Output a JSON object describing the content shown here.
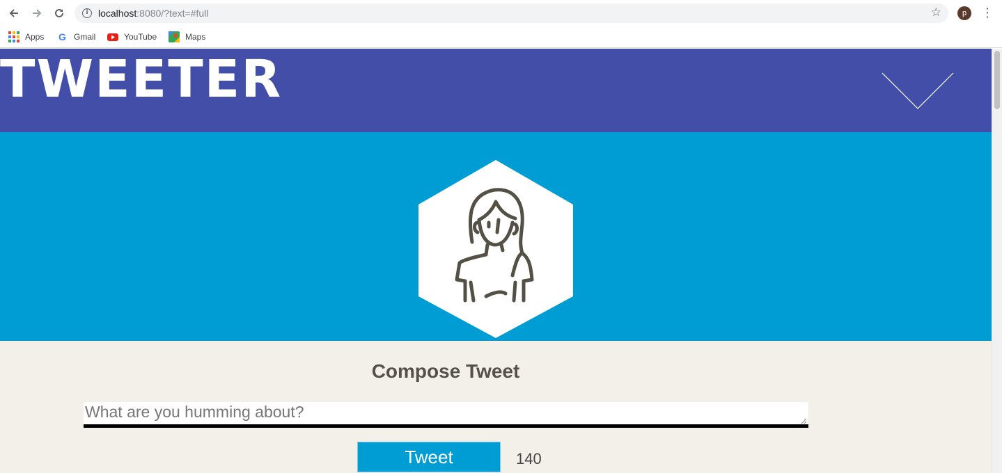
{
  "browser": {
    "url_host": "localhost",
    "url_path": ":8080/?text=#full",
    "profile_initial": "p",
    "bookmarks": [
      {
        "label": "Apps",
        "icon": "apps-grid-icon"
      },
      {
        "label": "Gmail",
        "icon": "google-icon"
      },
      {
        "label": "YouTube",
        "icon": "youtube-icon"
      },
      {
        "label": "Maps",
        "icon": "maps-icon"
      }
    ]
  },
  "header": {
    "logo": "TWEETER",
    "toggle_icon": "chevron-down-icon",
    "bg_color": "#434ea8"
  },
  "hero": {
    "avatar_icon": "user-avatar-icon",
    "bg_color": "#009dd4"
  },
  "compose": {
    "title": "Compose Tweet",
    "placeholder": "What are you humming about?",
    "button_label": "Tweet",
    "char_counter": "140"
  }
}
